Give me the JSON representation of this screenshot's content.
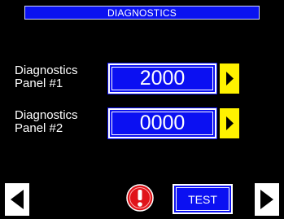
{
  "header": {
    "title": "DIAGNOSTICS"
  },
  "panels": [
    {
      "label_line1": "Diagnostics",
      "label_line2": "Panel #1",
      "value": "2000",
      "arrow_icon": "play-right-icon"
    },
    {
      "label_line1": "Diagnostics",
      "label_line2": "Panel #2",
      "value": "0000",
      "arrow_icon": "play-right-icon"
    }
  ],
  "footer": {
    "prev_icon": "triangle-left-icon",
    "next_icon": "triangle-right-icon",
    "alert_icon": "exclamation-alert-icon",
    "test_label": "TEST"
  },
  "colors": {
    "background": "#000000",
    "panel_blue": "#0b10f2",
    "arrow_yellow": "#fff200",
    "alert_red": "#e0141a",
    "text": "#ffffff"
  }
}
